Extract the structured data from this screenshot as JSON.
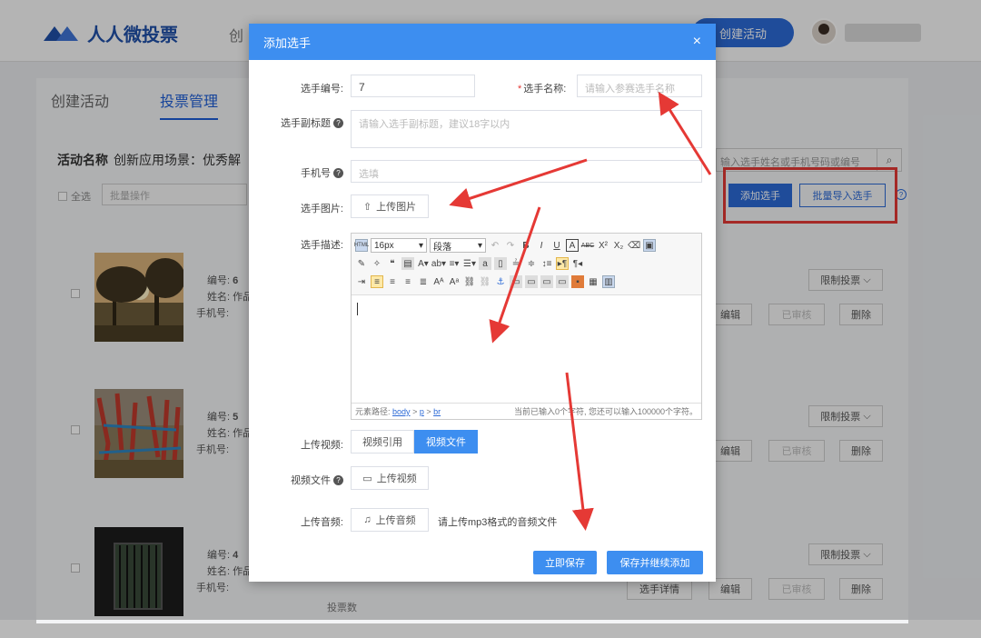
{
  "header": {
    "logo_text": "人人微投票",
    "nav_create": "创",
    "create_activity": "创建活动"
  },
  "tabs": [
    "创建活动",
    "投票管理"
  ],
  "activity": {
    "label": "活动名称",
    "name": "创新应用场景：优秀解"
  },
  "toolbar": {
    "select_all": "全选",
    "batch_ops": "批量操作",
    "search_placeholder": "输入选手姓名或手机号码或编号",
    "add_player": "添加选手",
    "batch_import": "批量导入选手"
  },
  "rows": [
    {
      "num_label": "编号:",
      "num": "6",
      "name_label": "姓名: 作品",
      "phone_label": "手机号:",
      "limit": "限制投票",
      "ops": [
        "编辑",
        "已审核",
        "删除"
      ]
    },
    {
      "num_label": "编号:",
      "num": "5",
      "name_label": "姓名: 作品",
      "phone_label": "手机号:",
      "limit": "限制投票",
      "ops": [
        "编辑",
        "已审核",
        "删除"
      ]
    },
    {
      "num_label": "编号:",
      "num": "4",
      "name_label": "姓名: 作品",
      "phone_label": "手机号:",
      "votes": "投票数",
      "limit": "限制投票",
      "ops": [
        "选手详情",
        "编辑",
        "已审核",
        "删除"
      ]
    }
  ],
  "modal": {
    "title": "添加选手",
    "close": "×",
    "player_no_label": "选手编号:",
    "player_no_value": "7",
    "player_name_label": "选手名称:",
    "player_name_placeholder": "请输入参赛选手名称",
    "subtitle_label": "选手副标题",
    "subtitle_placeholder": "请输入选手副标题，建议18字以内",
    "phone_label": "手机号",
    "phone_placeholder": "选填",
    "image_label": "选手图片:",
    "upload_image": "上传图片",
    "desc_label": "选手描述:",
    "editor": {
      "font_size": "16px",
      "paragraph": "段落",
      "path_label": "元素路径:",
      "path": [
        "body",
        "p",
        "br"
      ],
      "count_text": "当前已输入0个字符, 您还可以输入100000个字符。"
    },
    "video_label": "上传视频:",
    "video_tabs": [
      "视频引用",
      "视频文件"
    ],
    "video_file_label": "视频文件",
    "upload_video": "上传视频",
    "audio_label": "上传音频:",
    "upload_audio": "上传音频",
    "audio_tip": "请上传mp3格式的音频文件",
    "save": "立即保存",
    "save_continue": "保存并继续添加"
  },
  "colors": {
    "primary": "#3d8ef0",
    "brand": "#1f4fa8",
    "annotation_red": "#e53935"
  }
}
